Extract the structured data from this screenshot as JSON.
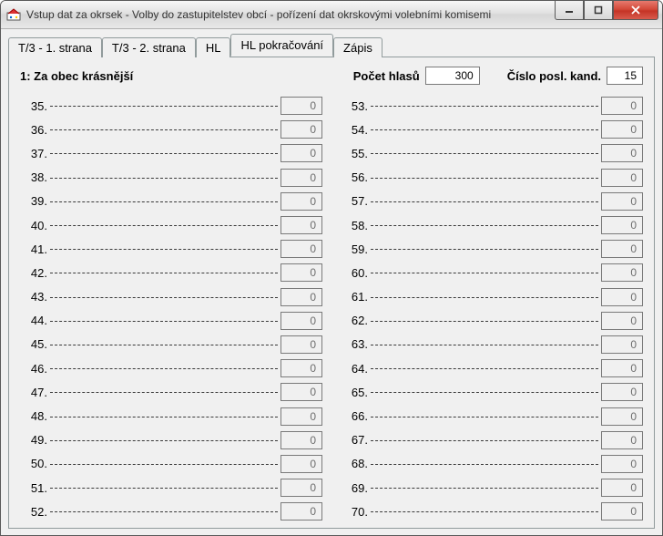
{
  "window": {
    "title": "Vstup dat za okrsek - Volby do zastupitelstev obcí - pořízení dat okrskovými volebními komisemi"
  },
  "tabs": [
    {
      "id": "t1",
      "label": "T/3 - 1. strana"
    },
    {
      "id": "t2",
      "label": "T/3 - 2. strana"
    },
    {
      "id": "hl",
      "label": "HL"
    },
    {
      "id": "hlp",
      "label": "HL pokračování"
    },
    {
      "id": "zapis",
      "label": "Zápis"
    }
  ],
  "active_tab": "hlp",
  "header": {
    "subject": "1: Za obec krásnější",
    "pocet_label": "Počet hlasů",
    "pocet_value": "300",
    "kand_label": "Číslo posl. kand.",
    "kand_value": "15"
  },
  "left_rows": [
    {
      "n": "35.",
      "v": "0"
    },
    {
      "n": "36.",
      "v": "0"
    },
    {
      "n": "37.",
      "v": "0"
    },
    {
      "n": "38.",
      "v": "0"
    },
    {
      "n": "39.",
      "v": "0"
    },
    {
      "n": "40.",
      "v": "0"
    },
    {
      "n": "41.",
      "v": "0"
    },
    {
      "n": "42.",
      "v": "0"
    },
    {
      "n": "43.",
      "v": "0"
    },
    {
      "n": "44.",
      "v": "0"
    },
    {
      "n": "45.",
      "v": "0"
    },
    {
      "n": "46.",
      "v": "0"
    },
    {
      "n": "47.",
      "v": "0"
    },
    {
      "n": "48.",
      "v": "0"
    },
    {
      "n": "49.",
      "v": "0"
    },
    {
      "n": "50.",
      "v": "0"
    },
    {
      "n": "51.",
      "v": "0"
    },
    {
      "n": "52.",
      "v": "0"
    }
  ],
  "right_rows": [
    {
      "n": "53.",
      "v": "0"
    },
    {
      "n": "54.",
      "v": "0"
    },
    {
      "n": "55.",
      "v": "0"
    },
    {
      "n": "56.",
      "v": "0"
    },
    {
      "n": "57.",
      "v": "0"
    },
    {
      "n": "58.",
      "v": "0"
    },
    {
      "n": "59.",
      "v": "0"
    },
    {
      "n": "60.",
      "v": "0"
    },
    {
      "n": "61.",
      "v": "0"
    },
    {
      "n": "62.",
      "v": "0"
    },
    {
      "n": "63.",
      "v": "0"
    },
    {
      "n": "64.",
      "v": "0"
    },
    {
      "n": "65.",
      "v": "0"
    },
    {
      "n": "66.",
      "v": "0"
    },
    {
      "n": "67.",
      "v": "0"
    },
    {
      "n": "68.",
      "v": "0"
    },
    {
      "n": "69.",
      "v": "0"
    },
    {
      "n": "70.",
      "v": "0"
    }
  ]
}
